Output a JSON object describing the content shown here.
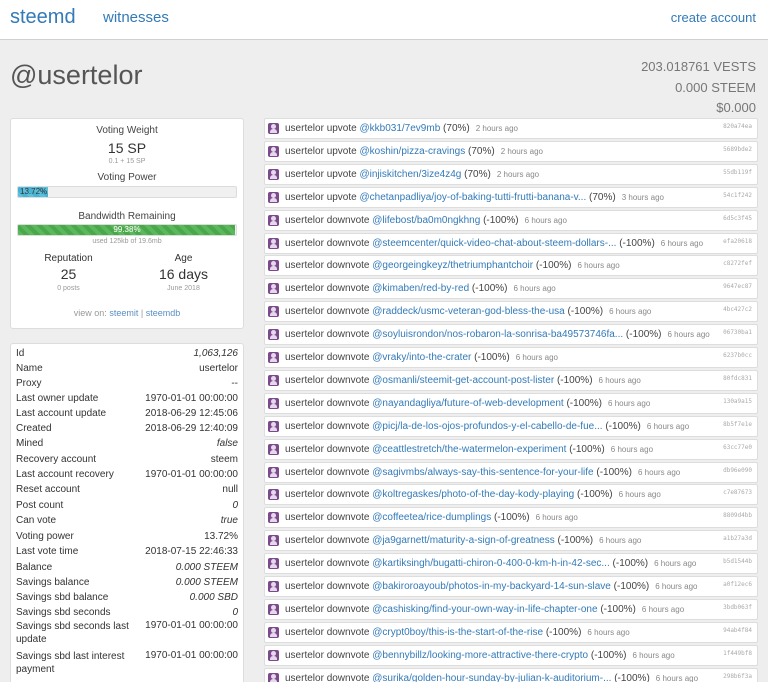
{
  "nav": {
    "brand": "steemd",
    "witnesses": "witnesses",
    "create_account": "create account"
  },
  "account": {
    "username": "@usertelor",
    "vests": "203.018761 VESTS",
    "steem": "0.000 STEEM",
    "usd": "$0.000"
  },
  "stats": {
    "voting_weight_label": "Voting Weight",
    "voting_weight_value": "15 SP",
    "voting_weight_sub": "0.1 + 15 SP",
    "voting_power_label": "Voting Power",
    "voting_power_text": "13.72%",
    "voting_power_fraction": 0.1372,
    "bandwidth_label": "Bandwidth Remaining",
    "bandwidth_text": "99.38%",
    "bandwidth_fraction": 0.9938,
    "bandwidth_sub": "used 125kb of 19.6mb",
    "reputation_label": "Reputation",
    "reputation_value": "25",
    "reputation_sub": "0 posts",
    "age_label": "Age",
    "age_value": "16 days",
    "age_sub": "June 2018",
    "view_on_prefix": "view on:",
    "view_on_steemit": "steemit",
    "view_on_sep": "|",
    "view_on_steemdb": "steemdb"
  },
  "properties": [
    {
      "key": "Id",
      "value": "1,063,126",
      "italic": true
    },
    {
      "key": "Name",
      "value": "usertelor",
      "italic": false
    },
    {
      "key": "Proxy",
      "value": "--",
      "italic": false
    },
    {
      "key": "Last owner update",
      "value": "1970-01-01 00:00:00",
      "italic": false
    },
    {
      "key": "Last account update",
      "value": "2018-06-29 12:45:06",
      "italic": false
    },
    {
      "key": "Created",
      "value": "2018-06-29 12:40:09",
      "italic": false
    },
    {
      "key": "Mined",
      "value": "false",
      "italic": true
    },
    {
      "key": "Recovery account",
      "value": "steem",
      "italic": false
    },
    {
      "key": "Last account recovery",
      "value": "1970-01-01 00:00:00",
      "italic": false
    },
    {
      "key": "Reset account",
      "value": "null",
      "italic": false
    },
    {
      "key": "Post count",
      "value": "0",
      "italic": true
    },
    {
      "key": "Can vote",
      "value": "true",
      "italic": true
    },
    {
      "key": "Voting power",
      "value": "13.72%",
      "italic": false
    },
    {
      "key": "Last vote time",
      "value": "2018-07-15 22:46:33",
      "italic": false
    },
    {
      "key": "Balance",
      "value": "0.000 STEEM",
      "italic": true
    },
    {
      "key": "Savings balance",
      "value": "0.000 STEEM",
      "italic": true
    },
    {
      "key": "Savings sbd balance",
      "value": "0.000 SBD",
      "italic": true
    },
    {
      "key": "Savings sbd seconds",
      "value": "0",
      "italic": true
    },
    {
      "key": "Savings sbd seconds last update",
      "value": "1970-01-01 00:00:00",
      "italic": false
    },
    {
      "key": "Savings sbd last interest payment",
      "value": "1970-01-01 00:00:00",
      "italic": false
    }
  ],
  "votes": [
    {
      "voter": "usertelor",
      "action": "upvote",
      "link": "@kkb031/7ev9mb",
      "weight": "(70%)",
      "time": "2 hours ago",
      "hash": "820a74ea"
    },
    {
      "voter": "usertelor",
      "action": "upvote",
      "link": "@koshin/pizza-cravings",
      "weight": "(70%)",
      "time": "2 hours ago",
      "hash": "5689bde2"
    },
    {
      "voter": "usertelor",
      "action": "upvote",
      "link": "@injiskitchen/3ize4z4g",
      "weight": "(70%)",
      "time": "2 hours ago",
      "hash": "55db119f"
    },
    {
      "voter": "usertelor",
      "action": "upvote",
      "link": "@chetanpadliya/joy-of-baking-tutti-frutti-banana-v...",
      "weight": "(70%)",
      "time": "3 hours ago",
      "hash": "54c1f242"
    },
    {
      "voter": "usertelor",
      "action": "downvote",
      "link": "@lifebost/ba0m0ngkhng",
      "weight": "(-100%)",
      "time": "6 hours ago",
      "hash": "6d5c3f45"
    },
    {
      "voter": "usertelor",
      "action": "downvote",
      "link": "@steemcenter/quick-video-chat-about-steem-dollars-...",
      "weight": "(-100%)",
      "time": "6 hours ago",
      "hash": "efa20618"
    },
    {
      "voter": "usertelor",
      "action": "downvote",
      "link": "@georgeingkeyz/thetriumphantchoir",
      "weight": "(-100%)",
      "time": "6 hours ago",
      "hash": "c8272fef"
    },
    {
      "voter": "usertelor",
      "action": "downvote",
      "link": "@kimaben/red-by-red",
      "weight": "(-100%)",
      "time": "6 hours ago",
      "hash": "9647ec87"
    },
    {
      "voter": "usertelor",
      "action": "downvote",
      "link": "@raddeck/usmc-veteran-god-bless-the-usa",
      "weight": "(-100%)",
      "time": "6 hours ago",
      "hash": "4bc427c2"
    },
    {
      "voter": "usertelor",
      "action": "downvote",
      "link": "@soyluisrondon/nos-robaron-la-sonrisa-ba49573746fa...",
      "weight": "(-100%)",
      "time": "6 hours ago",
      "hash": "06730ba1"
    },
    {
      "voter": "usertelor",
      "action": "downvote",
      "link": "@vraky/into-the-crater",
      "weight": "(-100%)",
      "time": "6 hours ago",
      "hash": "6237b0cc"
    },
    {
      "voter": "usertelor",
      "action": "downvote",
      "link": "@osmanli/steemit-get-account-post-lister",
      "weight": "(-100%)",
      "time": "6 hours ago",
      "hash": "80fdc831"
    },
    {
      "voter": "usertelor",
      "action": "downvote",
      "link": "@nayandagliya/future-of-web-development",
      "weight": "(-100%)",
      "time": "6 hours ago",
      "hash": "130a9a15"
    },
    {
      "voter": "usertelor",
      "action": "downvote",
      "link": "@picj/la-de-los-ojos-profundos-y-el-cabello-de-fue...",
      "weight": "(-100%)",
      "time": "6 hours ago",
      "hash": "8b5f7e1e"
    },
    {
      "voter": "usertelor",
      "action": "downvote",
      "link": "@ceattlestretch/the-watermelon-experiment",
      "weight": "(-100%)",
      "time": "6 hours ago",
      "hash": "63cc77e0"
    },
    {
      "voter": "usertelor",
      "action": "downvote",
      "link": "@sagivmbs/always-say-this-sentence-for-your-life",
      "weight": "(-100%)",
      "time": "6 hours ago",
      "hash": "db96e090"
    },
    {
      "voter": "usertelor",
      "action": "downvote",
      "link": "@koltregaskes/photo-of-the-day-kody-playing",
      "weight": "(-100%)",
      "time": "6 hours ago",
      "hash": "c7e87673"
    },
    {
      "voter": "usertelor",
      "action": "downvote",
      "link": "@coffeetea/rice-dumplings",
      "weight": "(-100%)",
      "time": "6 hours ago",
      "hash": "8809d4bb"
    },
    {
      "voter": "usertelor",
      "action": "downvote",
      "link": "@ja9garnett/maturity-a-sign-of-greatness",
      "weight": "(-100%)",
      "time": "6 hours ago",
      "hash": "a1b27a3d"
    },
    {
      "voter": "usertelor",
      "action": "downvote",
      "link": "@kartiksingh/bugatti-chiron-0-400-0-km-h-in-42-sec...",
      "weight": "(-100%)",
      "time": "6 hours ago",
      "hash": "b5d1544b"
    },
    {
      "voter": "usertelor",
      "action": "downvote",
      "link": "@bakiroroayoub/photos-in-my-backyard-14-sun-slave",
      "weight": "(-100%)",
      "time": "6 hours ago",
      "hash": "a0f12ec6"
    },
    {
      "voter": "usertelor",
      "action": "downvote",
      "link": "@cashisking/find-your-own-way-in-life-chapter-one",
      "weight": "(-100%)",
      "time": "6 hours ago",
      "hash": "3bdb063f"
    },
    {
      "voter": "usertelor",
      "action": "downvote",
      "link": "@crypt0boy/this-is-the-start-of-the-rise",
      "weight": "(-100%)",
      "time": "6 hours ago",
      "hash": "94ab4f84"
    },
    {
      "voter": "usertelor",
      "action": "downvote",
      "link": "@bennybillz/looking-more-attractive-there-crypto",
      "weight": "(-100%)",
      "time": "6 hours ago",
      "hash": "1f449bf8"
    },
    {
      "voter": "usertelor",
      "action": "downvote",
      "link": "@surika/golden-hour-sunday-by-julian-k-auditorium-...",
      "weight": "(-100%)",
      "time": "6 hours ago",
      "hash": "298b6f3a"
    }
  ]
}
